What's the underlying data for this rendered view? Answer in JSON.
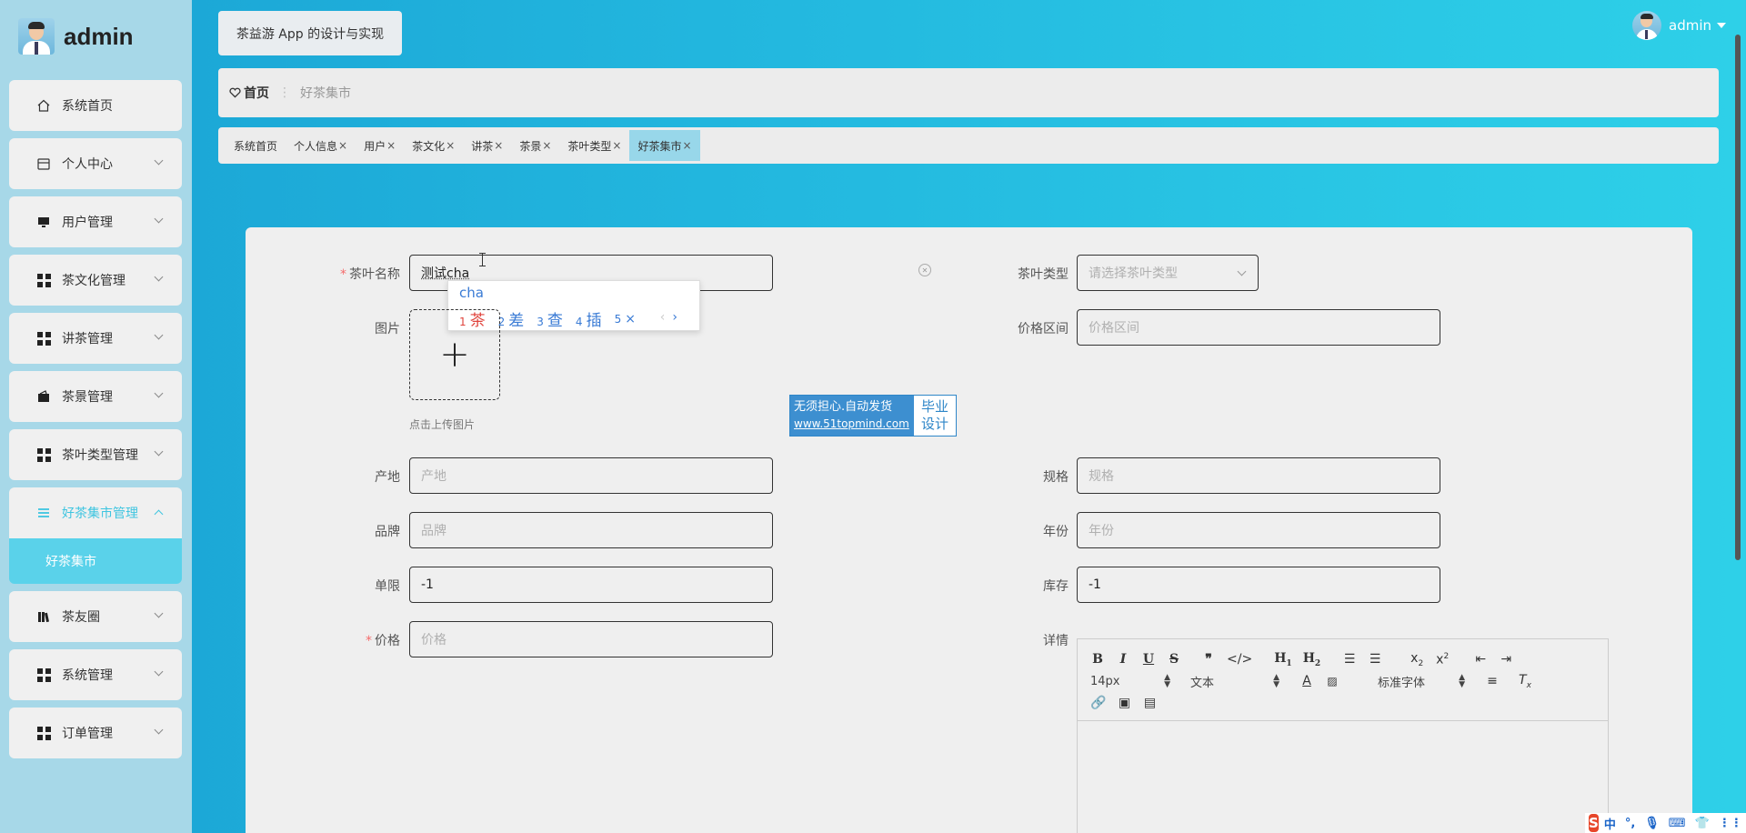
{
  "sidebar": {
    "brand": "admin",
    "items": [
      {
        "label": "系统首页",
        "icon": "home-icon"
      },
      {
        "label": "个人中心",
        "icon": "calendar-icon"
      },
      {
        "label": "用户管理",
        "icon": "monitor-icon"
      },
      {
        "label": "茶文化管理",
        "icon": "grid-icon"
      },
      {
        "label": "讲茶管理",
        "icon": "grid-icon"
      },
      {
        "label": "茶景管理",
        "icon": "wallet-icon"
      },
      {
        "label": "茶叶类型管理",
        "icon": "grid-icon"
      },
      {
        "label": "好茶集市管理",
        "icon": "menu-icon"
      },
      {
        "label": "茶友圈",
        "icon": "book-icon"
      },
      {
        "label": "系统管理",
        "icon": "grid-icon"
      },
      {
        "label": "订单管理",
        "icon": "grid-icon"
      }
    ],
    "active_sub": "好茶集市"
  },
  "header": {
    "title": "茶益游 App 的设计与实现",
    "user": "admin"
  },
  "breadcrumb": {
    "home": "首页",
    "current": "好茶集市"
  },
  "tags": [
    {
      "label": "系统首页",
      "closable": false
    },
    {
      "label": "个人信息",
      "closable": true
    },
    {
      "label": "用户",
      "closable": true
    },
    {
      "label": "茶文化",
      "closable": true
    },
    {
      "label": "讲茶",
      "closable": true
    },
    {
      "label": "茶景",
      "closable": true
    },
    {
      "label": "茶叶类型",
      "closable": true
    },
    {
      "label": "好茶集市",
      "closable": true
    }
  ],
  "form": {
    "name_label": "茶叶名称",
    "name_value": "测试cha",
    "type_label": "茶叶类型",
    "type_placeholder": "请选择茶叶类型",
    "image_label": "图片",
    "upload_hint": "点击上传图片",
    "price_range_label": "价格区间",
    "price_range_placeholder": "价格区间",
    "origin_label": "产地",
    "origin_placeholder": "产地",
    "spec_label": "规格",
    "spec_placeholder": "规格",
    "brand_label": "品牌",
    "brand_placeholder": "品牌",
    "year_label": "年份",
    "year_placeholder": "年份",
    "limit_label": "单限",
    "limit_value": "-1",
    "stock_label": "库存",
    "stock_value": "-1",
    "price_label": "价格",
    "price_placeholder": "价格",
    "detail_label": "详情",
    "required_mark": "*"
  },
  "ime": {
    "composition": "cha",
    "candidates": [
      {
        "num": "1",
        "text": "茶"
      },
      {
        "num": "2",
        "text": "差"
      },
      {
        "num": "3",
        "text": "查"
      },
      {
        "num": "4",
        "text": "插"
      },
      {
        "num": "5",
        "text": "×"
      }
    ],
    "prev": "‹",
    "next": "›"
  },
  "watermark": {
    "line1": "无须担心.自动发货",
    "url": "www.51topmind.com",
    "right1": "毕业",
    "right2": "设计"
  },
  "editor": {
    "font_size": "14px",
    "block": "文本",
    "font": "标准字体"
  },
  "tray": {
    "lang": "中",
    "punct": "°,"
  }
}
